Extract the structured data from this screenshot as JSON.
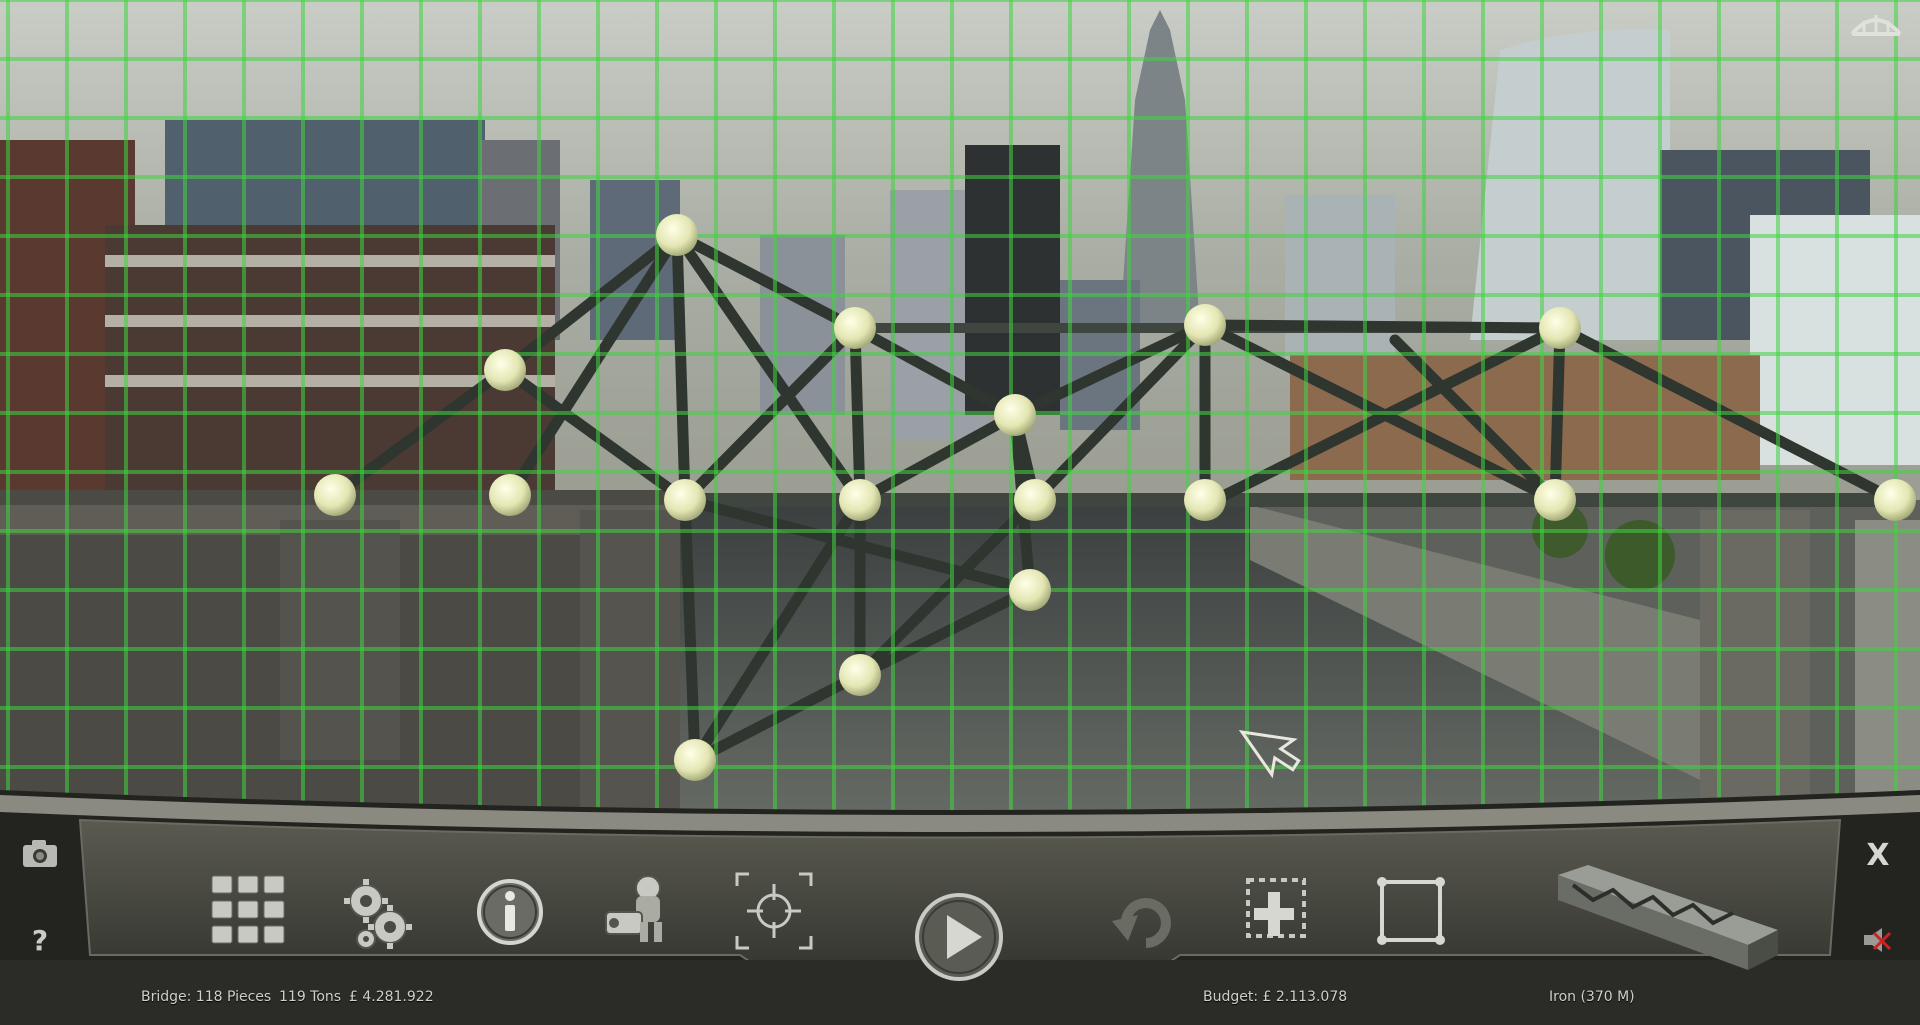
{
  "toolbar": {
    "menu": "menu-grid-icon",
    "settings": "gears-icon",
    "info": "info-icon",
    "camera_person": "camera-operator-icon",
    "focus": "target-icon",
    "play": "play-icon",
    "undo": "undo-icon",
    "add_node": "add-selection-icon",
    "select_box": "select-box-icon",
    "material": "iron-beam-icon"
  },
  "side": {
    "help_label": "?",
    "close_label": "X"
  },
  "status": {
    "bridge": "Bridge: 118 Pieces",
    "weight": "119 Tons",
    "cost": "£ 4.281.922",
    "budget": "Budget: £ 2.113.078",
    "material": "Iron (370 M)"
  },
  "colors": {
    "grid": "#3fd43f",
    "panel": "#3b3c36",
    "node": "#e6e8b8",
    "beam": "#3a3f3a"
  }
}
